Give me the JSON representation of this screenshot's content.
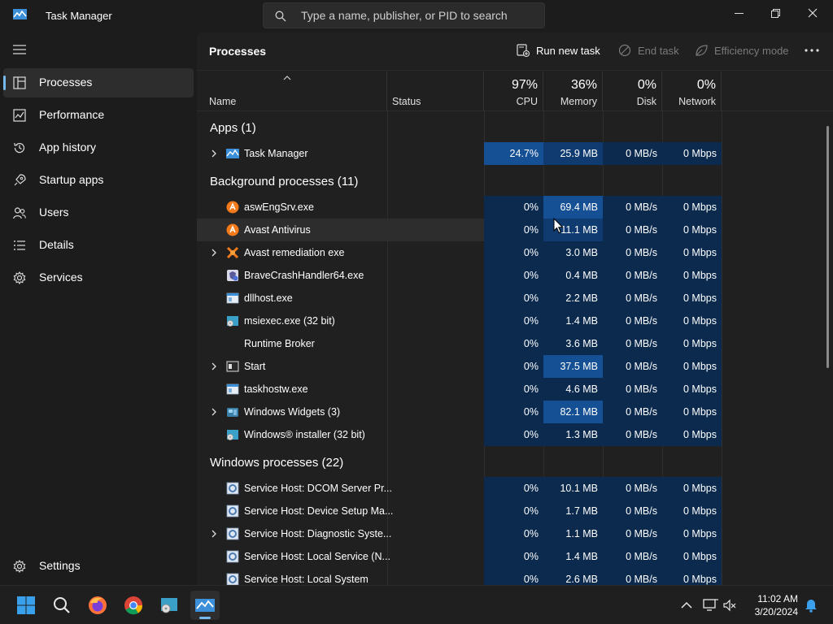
{
  "window": {
    "title": "Task Manager",
    "search_placeholder": "Type a name, publisher, or PID to search"
  },
  "sidebar": {
    "items": [
      {
        "label": "Processes",
        "icon": "processes-icon",
        "active": true
      },
      {
        "label": "Performance",
        "icon": "performance-icon"
      },
      {
        "label": "App history",
        "icon": "history-icon"
      },
      {
        "label": "Startup apps",
        "icon": "startup-icon"
      },
      {
        "label": "Users",
        "icon": "users-icon"
      },
      {
        "label": "Details",
        "icon": "details-icon"
      },
      {
        "label": "Services",
        "icon": "services-icon"
      }
    ],
    "settings_label": "Settings"
  },
  "toolbar": {
    "page_title": "Processes",
    "run_new_task": "Run new task",
    "end_task": "End task",
    "efficiency_mode": "Efficiency mode"
  },
  "header": {
    "name": "Name",
    "status": "Status",
    "cpu_pct": "97%",
    "cpu": "CPU",
    "memory_pct": "36%",
    "memory": "Memory",
    "disk_pct": "0%",
    "disk": "Disk",
    "network_pct": "0%",
    "network": "Network"
  },
  "groups": {
    "apps": "Apps (1)",
    "background": "Background processes (11)",
    "windows": "Windows processes (22)"
  },
  "processes": [
    {
      "name": "Task Manager",
      "cpu": "24.7%",
      "mem": "25.9 MB",
      "disk": "0 MB/s",
      "net": "0 Mbps",
      "icon": "task-manager-icon"
    },
    {
      "name": "aswEngSrv.exe",
      "cpu": "0%",
      "mem": "69.4 MB",
      "disk": "0 MB/s",
      "net": "0 Mbps",
      "icon": "avast-icon"
    },
    {
      "name": "Avast Antivirus",
      "cpu": "0%",
      "mem": "11.1 MB",
      "disk": "0 MB/s",
      "net": "0 Mbps",
      "icon": "avast-icon"
    },
    {
      "name": "Avast remediation exe",
      "cpu": "0%",
      "mem": "3.0 MB",
      "disk": "0 MB/s",
      "net": "0 Mbps",
      "icon": "avast-remediation-icon"
    },
    {
      "name": "BraveCrashHandler64.exe",
      "cpu": "0%",
      "mem": "0.4 MB",
      "disk": "0 MB/s",
      "net": "0 Mbps",
      "icon": "brave-crash-icon"
    },
    {
      "name": "dllhost.exe",
      "cpu": "0%",
      "mem": "2.2 MB",
      "disk": "0 MB/s",
      "net": "0 Mbps",
      "icon": "window-app-icon"
    },
    {
      "name": "msiexec.exe (32 bit)",
      "cpu": "0%",
      "mem": "1.4 MB",
      "disk": "0 MB/s",
      "net": "0 Mbps",
      "icon": "installer-icon"
    },
    {
      "name": "Runtime Broker",
      "cpu": "0%",
      "mem": "3.6 MB",
      "disk": "0 MB/s",
      "net": "0 Mbps",
      "icon": "blank-icon"
    },
    {
      "name": "Start",
      "cpu": "0%",
      "mem": "37.5 MB",
      "disk": "0 MB/s",
      "net": "0 Mbps",
      "icon": "window-app-icon"
    },
    {
      "name": "taskhostw.exe",
      "cpu": "0%",
      "mem": "4.6 MB",
      "disk": "0 MB/s",
      "net": "0 Mbps",
      "icon": "window-app-icon"
    },
    {
      "name": "Windows Widgets (3)",
      "cpu": "0%",
      "mem": "82.1 MB",
      "disk": "0 MB/s",
      "net": "0 Mbps",
      "icon": "widgets-icon"
    },
    {
      "name": "Windows® installer (32 bit)",
      "cpu": "0%",
      "mem": "1.3 MB",
      "disk": "0 MB/s",
      "net": "0 Mbps",
      "icon": "installer-icon"
    },
    {
      "name": "Service Host: DCOM Server Pr...",
      "cpu": "0%",
      "mem": "10.1 MB",
      "disk": "0 MB/s",
      "net": "0 Mbps",
      "icon": "service-host-icon"
    },
    {
      "name": "Service Host: Device Setup Ma...",
      "cpu": "0%",
      "mem": "1.7 MB",
      "disk": "0 MB/s",
      "net": "0 Mbps",
      "icon": "service-host-icon"
    },
    {
      "name": "Service Host: Diagnostic Syste...",
      "cpu": "0%",
      "mem": "1.1 MB",
      "disk": "0 MB/s",
      "net": "0 Mbps",
      "icon": "service-host-icon"
    },
    {
      "name": "Service Host: Local Service (N...",
      "cpu": "0%",
      "mem": "1.4 MB",
      "disk": "0 MB/s",
      "net": "0 Mbps",
      "icon": "service-host-icon"
    },
    {
      "name": "Service Host: Local System",
      "cpu": "0%",
      "mem": "2.6 MB",
      "disk": "0 MB/s",
      "net": "0 Mbps",
      "icon": "service-host-icon"
    }
  ],
  "taskbar": {
    "time": "11:02 AM",
    "date": "3/20/2024"
  },
  "colors": {
    "accent": "#76b9ed",
    "heat_light": "#0b2a4e",
    "heat_mid": "#0f3b70",
    "heat_strong": "#154f94"
  }
}
